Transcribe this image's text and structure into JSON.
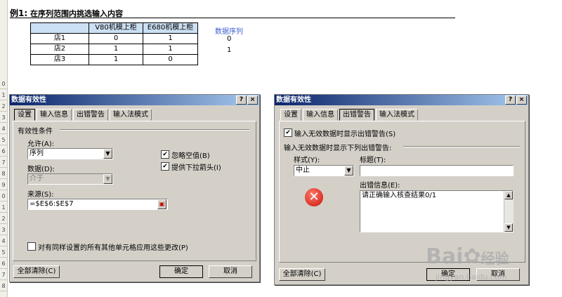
{
  "sheet": {
    "title_prefix": "例1:",
    "title_text": "在序列范围内挑选输入内容",
    "col_headers": [
      "V80机模上柜",
      "E680机模上柜"
    ],
    "rows": [
      {
        "label": "店1",
        "v1": "0",
        "v2": "1"
      },
      {
        "label": "店2",
        "v1": "1",
        "v2": "1"
      },
      {
        "label": "店3",
        "v1": "1",
        "v2": "0"
      }
    ],
    "seq_header": "数据序列",
    "seq_values": [
      "0",
      "1"
    ],
    "row_numbers": [
      "0",
      "1",
      "2",
      "3",
      "4",
      "5",
      "6",
      "7",
      "8",
      "9",
      "0",
      "1",
      "2",
      "3",
      "4",
      "5",
      "6",
      "7",
      "8"
    ]
  },
  "dialog1": {
    "title": "数据有效性",
    "help_btn": "?",
    "close_btn": "×",
    "tabs": [
      "设置",
      "输入信息",
      "出错警告",
      "输入法模式"
    ],
    "group_label": "有效性条件",
    "allow_label": "允许(A):",
    "allow_value": "序列",
    "data_label": "数据(D):",
    "data_value": "介于",
    "ignore_blank": "忽略空值(B)",
    "dropdown_arrow": "提供下拉箭头(I)",
    "source_label": "来源(S):",
    "source_value": "=$E$6:$E$7",
    "apply_all": "对有同样设置的所有其他单元格应用这些更改(P)",
    "clear_all": "全部清除(C)",
    "ok": "确定",
    "cancel": "取消"
  },
  "dialog2": {
    "title": "数据有效性",
    "help_btn": "?",
    "close_btn": "×",
    "tabs": [
      "设置",
      "输入信息",
      "出错警告",
      "输入法模式"
    ],
    "show_alert": "输入无效数据时显示出错警告(S)",
    "group_label": "输入无效数据时显示下列出错警告:",
    "style_label": "样式(Y):",
    "style_value": "中止",
    "title_label": "标题(T):",
    "title_value": "",
    "message_label": "出错信息(E):",
    "message_value": "请正确输入核查结果0/1",
    "clear_all": "全部清除(C)",
    "ok": "确定",
    "cancel": "取消"
  },
  "watermark": {
    "brand": "Bai",
    "brand2": "经验",
    "url": "jingyan.baidu.com"
  }
}
